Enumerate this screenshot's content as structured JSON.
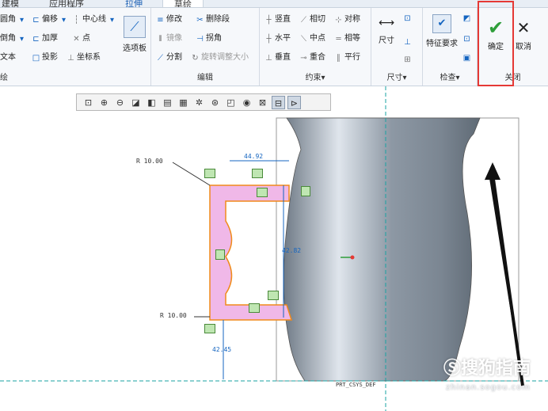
{
  "tabs": [
    {
      "label": "建模"
    },
    {
      "label": "应用程序"
    },
    {
      "label": "拉伸"
    },
    {
      "label": "草绘"
    }
  ],
  "groups": {
    "sketch": {
      "label": "绘",
      "items": [
        {
          "label": "圆角"
        },
        {
          "label": "倒角"
        },
        {
          "label": "文本"
        }
      ]
    },
    "edit_left": {
      "items": [
        {
          "label": "偏移"
        },
        {
          "label": "加厚"
        },
        {
          "label": "投影"
        }
      ]
    },
    "edit_mid": {
      "items": [
        {
          "label": "中心线"
        },
        {
          "label": "点"
        },
        {
          "label": "坐标系"
        }
      ]
    },
    "palette": {
      "label": "选项板"
    },
    "edit": {
      "label": "编辑",
      "items": [
        {
          "label": "修改"
        },
        {
          "label": "删除段"
        },
        {
          "label": "镜像"
        },
        {
          "label": "拐角"
        },
        {
          "label": "分割"
        },
        {
          "label": "旋转调整大小"
        }
      ]
    },
    "constrain": {
      "label": "约束",
      "items": [
        {
          "label": "竖直"
        },
        {
          "label": "相切"
        },
        {
          "label": "对称"
        },
        {
          "label": "水平"
        },
        {
          "label": "中点"
        },
        {
          "label": "相等"
        },
        {
          "label": "垂直"
        },
        {
          "label": "重合"
        },
        {
          "label": "平行"
        }
      ]
    },
    "dimension": {
      "label": "尺寸",
      "big": "尺寸"
    },
    "inspect": {
      "label": "检查",
      "big": "特征要求"
    },
    "close": {
      "label": "关闭",
      "ok": "确定",
      "cancel": "取消"
    }
  },
  "sketch": {
    "dims": {
      "r_top": "R 10.00",
      "r_bottom": "R 10.00",
      "width_top": "44.92",
      "height": "42.82",
      "bottom_len": "42.45"
    },
    "csys_label": "PRT_CSYS_DEF"
  },
  "watermark": {
    "text": "搜狗指南",
    "url": "zhinan.sogou.com"
  }
}
